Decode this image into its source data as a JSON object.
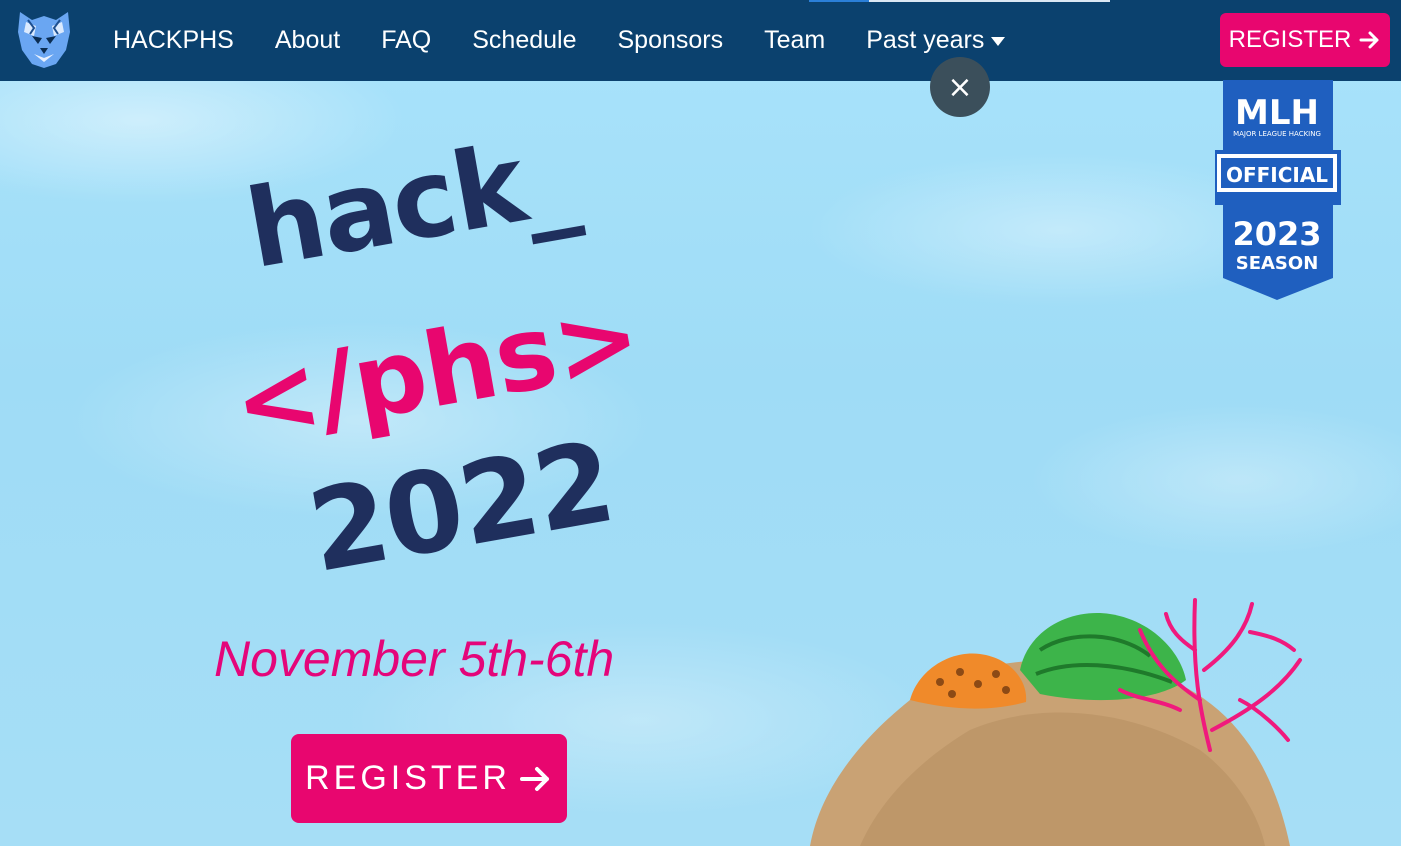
{
  "nav": {
    "brand": "HACKPHS",
    "items": [
      "About",
      "FAQ",
      "Schedule",
      "Sponsors",
      "Team"
    ],
    "dropdown_label": "Past years",
    "register_label": "REGISTER"
  },
  "close_label": "×",
  "mlh_badge": {
    "logo": "MLH",
    "subtitle": "MAJOR LEAGUE HACKING",
    "ribbon": "OFFICIAL",
    "year": "2023",
    "season": "SEASON"
  },
  "hero": {
    "line1": "hack_",
    "line2": "</phs>",
    "line3": "2022",
    "date": "November 5th-6th",
    "register_label": "REGISTER"
  },
  "icons": {
    "logo": "tiger-logo-icon",
    "dropdown": "caret-down-icon",
    "register_arrow": "arrow-right-icon",
    "close": "close-icon"
  },
  "colors": {
    "navbar": "#0b416e",
    "accent": "#e8066f",
    "title_navy": "#1f2f5d",
    "sky": "#9fdff8"
  }
}
